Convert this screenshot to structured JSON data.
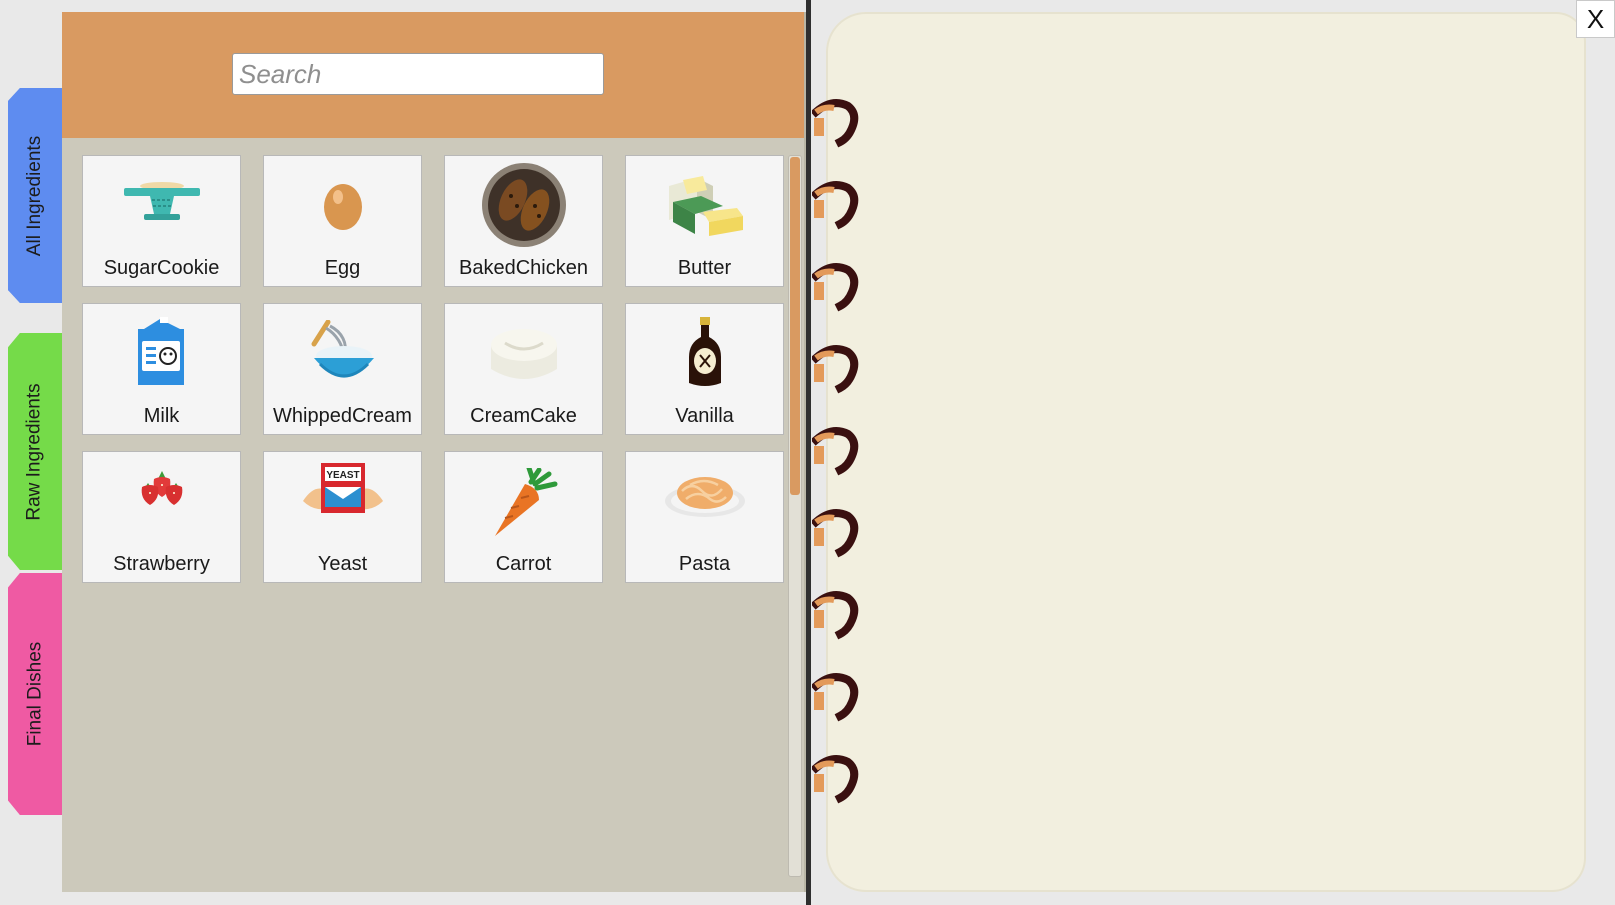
{
  "tabs": [
    {
      "label": "All Ingredients",
      "color": "#5e8cf0"
    },
    {
      "label": "Raw Ingredients",
      "color": "#75db49"
    },
    {
      "label": "Final Dishes",
      "color": "#ef5aa3"
    }
  ],
  "search": {
    "placeholder": "Search",
    "value": ""
  },
  "ingredients": [
    {
      "label": "SugarCookie",
      "icon": "cake-stand-icon"
    },
    {
      "label": "Egg",
      "icon": "egg-icon"
    },
    {
      "label": "BakedChicken",
      "icon": "baked-chicken-icon"
    },
    {
      "label": "Butter",
      "icon": "butter-icon"
    },
    {
      "label": "Milk",
      "icon": "milk-carton-icon"
    },
    {
      "label": "WhippedCream",
      "icon": "whipped-cream-bowl-icon"
    },
    {
      "label": "CreamCake",
      "icon": "cream-cake-icon"
    },
    {
      "label": "Vanilla",
      "icon": "vanilla-bottle-icon"
    },
    {
      "label": "Strawberry",
      "icon": "strawberry-icon"
    },
    {
      "label": "Yeast",
      "icon": "yeast-packet-icon"
    },
    {
      "label": "Carrot",
      "icon": "carrot-icon"
    },
    {
      "label": "Pasta",
      "icon": "pasta-plate-icon"
    }
  ],
  "close": {
    "label": "X"
  },
  "colors": {
    "header": "#d99a61",
    "panel": "#ccc9bb",
    "page": "#f2efdf",
    "ring": "#3a1010"
  }
}
